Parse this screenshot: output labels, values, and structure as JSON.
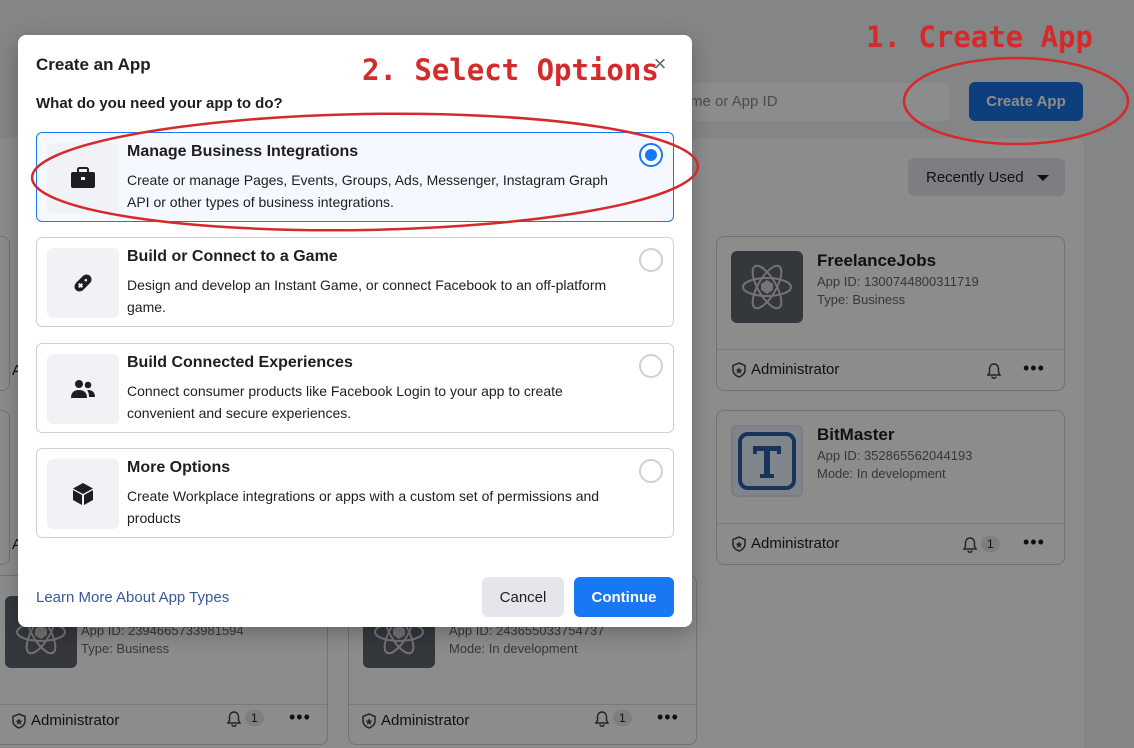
{
  "annotations": {
    "step1": "1. Create App",
    "step2": "2. Select Options"
  },
  "background": {
    "search_placeholder": "me or App ID",
    "create_app_button": "Create App",
    "sort_label": "Recently Used",
    "cards": [
      {
        "name": "FreelanceJobs",
        "app_id": "App ID: 1300744800311719",
        "type": "Type: Business",
        "role": "Administrator",
        "notifications": ""
      },
      {
        "name": "BitMaster",
        "app_id": "App ID: 352865562044193",
        "type": "Mode: In development",
        "role": "Administrator",
        "notifications": "1"
      },
      {
        "name": "",
        "app_id": "App ID: 2394665733981594",
        "type": "Type: Business",
        "role": "Administrator",
        "notifications": "1"
      },
      {
        "name": "",
        "app_id": "App ID: 243655033754737",
        "type": "Mode: In development",
        "role": "Administrator",
        "notifications": "1"
      }
    ],
    "partial_roles": [
      "A",
      "A"
    ]
  },
  "modal": {
    "title": "Create an App",
    "close_icon": "×",
    "question": "What do you need your app to do?",
    "options": [
      {
        "title": "Manage Business Integrations",
        "description": "Create or manage Pages, Events, Groups, Ads, Messenger, Instagram Graph API or other types of business integrations.",
        "icon": "briefcase-icon",
        "selected": true
      },
      {
        "title": "Build or Connect to a Game",
        "description": "Design and develop an Instant Game, or connect Facebook to an off-platform game.",
        "icon": "gamepad-icon",
        "selected": false
      },
      {
        "title": "Build Connected Experiences",
        "description": "Connect consumer products like Facebook Login to your app to create convenient and secure experiences.",
        "icon": "people-icon",
        "selected": false
      },
      {
        "title": "More Options",
        "description": "Create Workplace integrations or apps with a custom set of permissions and products",
        "icon": "cube-icon",
        "selected": false
      }
    ],
    "learn_more": "Learn More About App Types",
    "cancel": "Cancel",
    "continue": "Continue"
  },
  "colors": {
    "annotation_red": "#d42a2a",
    "primary_blue": "#1877f2",
    "link_blue": "#385898"
  }
}
